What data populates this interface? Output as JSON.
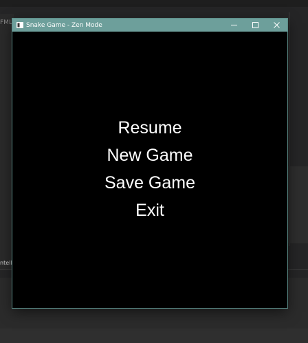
{
  "background": {
    "fragment_label": "FML",
    "cutoff_text": "ntell"
  },
  "window": {
    "title": "Snake Game - Zen Mode",
    "app_icon": "window-app-icon",
    "controls": {
      "minimize_icon": "minimize-icon",
      "maximize_icon": "maximize-icon",
      "close_icon": "close-icon"
    },
    "titlebar_color": "#6d9f9b",
    "canvas_color": "#000000"
  },
  "pause_menu": {
    "items": [
      {
        "label": "Resume"
      },
      {
        "label": "New Game"
      },
      {
        "label": "Save Game"
      },
      {
        "label": "Exit"
      }
    ],
    "text_color": "#ffffff"
  }
}
